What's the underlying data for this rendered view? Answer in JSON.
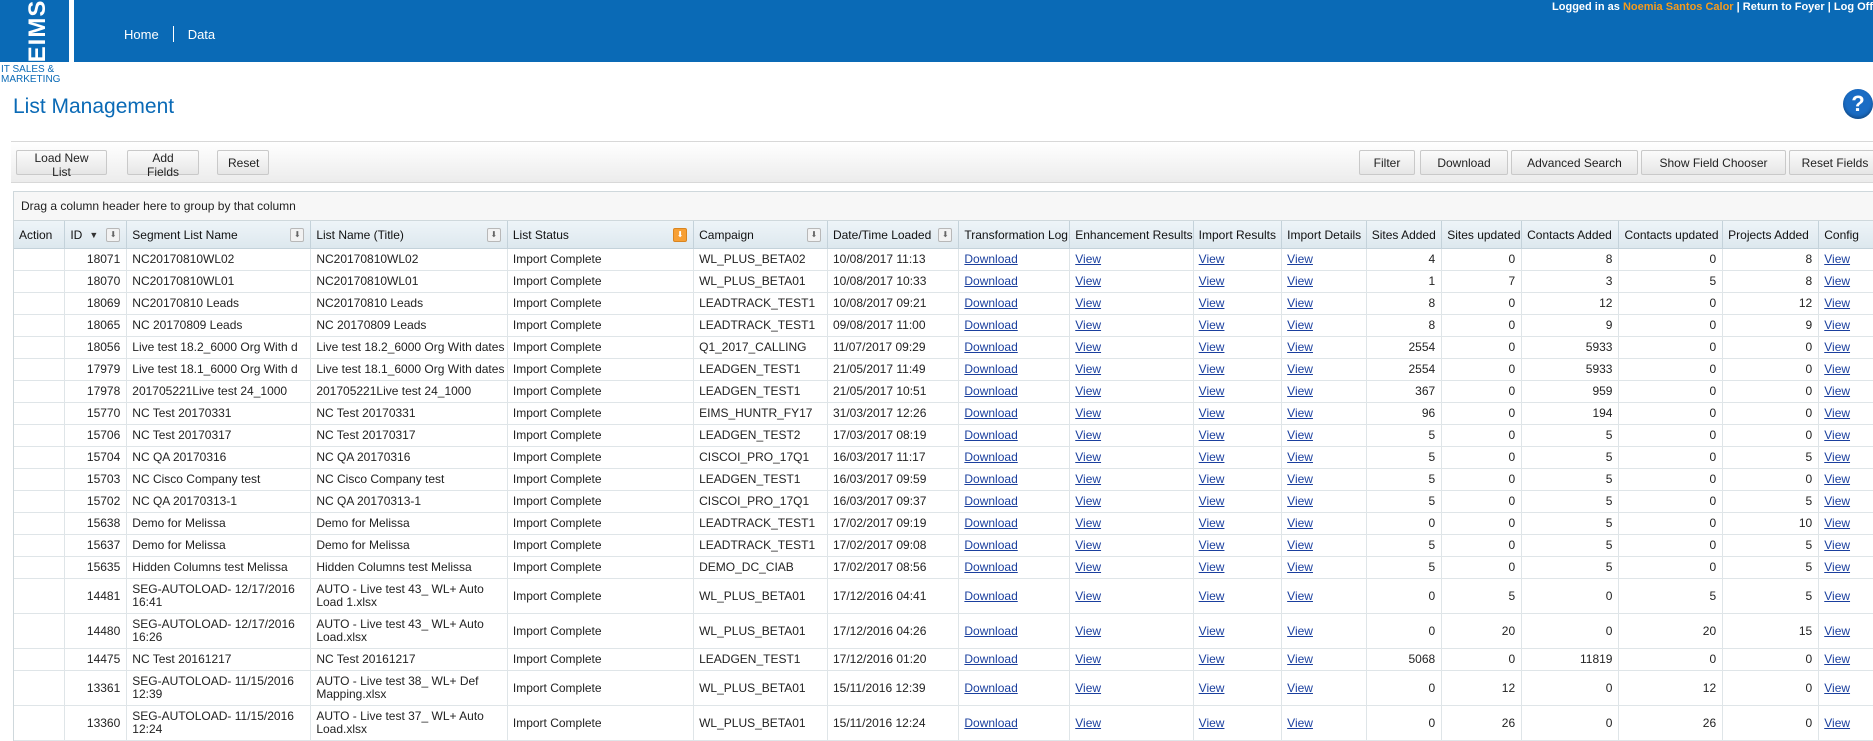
{
  "header": {
    "logo_text": "EIMS",
    "logo_subtitle": "IT SALES & MARKETING",
    "nav": [
      {
        "label": "Home"
      },
      {
        "label": "Data"
      }
    ],
    "user": {
      "prefix": "Logged in as",
      "name": "Noemia Santos Calor",
      "sep": "|",
      "return_label": "Return to Foyer",
      "logoff_label": "Log Off"
    }
  },
  "page": {
    "title": "List Management",
    "help_icon": "?"
  },
  "toolbar": {
    "left_buttons": [
      "Load New List",
      "Add Fields",
      "Reset"
    ],
    "right_buttons": [
      "Filter",
      "Download",
      "Advanced Search",
      "Show Field Chooser",
      "Reset Fields"
    ]
  },
  "grid": {
    "group_hint": "Drag a column header here to group by that column",
    "columns": [
      "Action",
      "ID",
      "Segment List Name",
      "List Name (Title)",
      "List Status",
      "Campaign",
      "Date/Time Loaded",
      "Transformation Log",
      "Enhancement Results",
      "Import Results",
      "Import Details",
      "Sites Added",
      "Sites updated",
      "Contacts Added",
      "Contacts updated",
      "Projects Added",
      "Config"
    ],
    "sort": {
      "column": "ID",
      "direction": "descending"
    },
    "active_filter_column": "List Status",
    "link_labels": {
      "download": "Download",
      "view": "View"
    },
    "rows": [
      {
        "id": "18071",
        "segment": "NC20170810WL02",
        "title": "NC20170810WL02",
        "status": "Import Complete",
        "campaign": "WL_PLUS_BETA02",
        "loaded": "10/08/2017 11:13",
        "sites_added": "4",
        "sites_updated": "0",
        "contacts_added": "8",
        "contacts_updated": "0",
        "projects_added": "8"
      },
      {
        "id": "18070",
        "segment": "NC20170810WL01",
        "title": "NC20170810WL01",
        "status": "Import Complete",
        "campaign": "WL_PLUS_BETA01",
        "loaded": "10/08/2017 10:33",
        "sites_added": "1",
        "sites_updated": "7",
        "contacts_added": "3",
        "contacts_updated": "5",
        "projects_added": "8"
      },
      {
        "id": "18069",
        "segment": "NC20170810 Leads",
        "title": "NC20170810 Leads",
        "status": "Import Complete",
        "campaign": "LEADTRACK_TEST1",
        "loaded": "10/08/2017 09:21",
        "sites_added": "8",
        "sites_updated": "0",
        "contacts_added": "12",
        "contacts_updated": "0",
        "projects_added": "12"
      },
      {
        "id": "18065",
        "segment": "NC 20170809 Leads",
        "title": "NC 20170809 Leads",
        "status": "Import Complete",
        "campaign": "LEADTRACK_TEST1",
        "loaded": "09/08/2017 11:00",
        "sites_added": "8",
        "sites_updated": "0",
        "contacts_added": "9",
        "contacts_updated": "0",
        "projects_added": "9"
      },
      {
        "id": "18056",
        "segment": "Live test 18.2_6000 Org With d",
        "title": "Live test 18.2_6000 Org With dates",
        "status": "Import Complete",
        "campaign": "Q1_2017_CALLING",
        "loaded": "11/07/2017 09:29",
        "sites_added": "2554",
        "sites_updated": "0",
        "contacts_added": "5933",
        "contacts_updated": "0",
        "projects_added": "0"
      },
      {
        "id": "17979",
        "segment": "Live test 18.1_6000 Org With d",
        "title": "Live test 18.1_6000 Org With dates",
        "status": "Import Complete",
        "campaign": "LEADGEN_TEST1",
        "loaded": "21/05/2017 11:49",
        "sites_added": "2554",
        "sites_updated": "0",
        "contacts_added": "5933",
        "contacts_updated": "0",
        "projects_added": "0"
      },
      {
        "id": "17978",
        "segment": "201705221Live test 24_1000",
        "title": "201705221Live test 24_1000",
        "status": "Import Complete",
        "campaign": "LEADGEN_TEST1",
        "loaded": "21/05/2017 10:51",
        "sites_added": "367",
        "sites_updated": "0",
        "contacts_added": "959",
        "contacts_updated": "0",
        "projects_added": "0"
      },
      {
        "id": "15770",
        "segment": "NC Test 20170331",
        "title": "NC Test 20170331",
        "status": "Import Complete",
        "campaign": "EIMS_HUNTR_FY17",
        "loaded": "31/03/2017 12:26",
        "sites_added": "96",
        "sites_updated": "0",
        "contacts_added": "194",
        "contacts_updated": "0",
        "projects_added": "0"
      },
      {
        "id": "15706",
        "segment": "NC Test 20170317",
        "title": "NC Test 20170317",
        "status": "Import Complete",
        "campaign": "LEADGEN_TEST2",
        "loaded": "17/03/2017 08:19",
        "sites_added": "5",
        "sites_updated": "0",
        "contacts_added": "5",
        "contacts_updated": "0",
        "projects_added": "0"
      },
      {
        "id": "15704",
        "segment": "NC QA 20170316",
        "title": "NC QA 20170316",
        "status": "Import Complete",
        "campaign": "CISCOI_PRO_17Q1",
        "loaded": "16/03/2017 11:17",
        "sites_added": "5",
        "sites_updated": "0",
        "contacts_added": "5",
        "contacts_updated": "0",
        "projects_added": "5"
      },
      {
        "id": "15703",
        "segment": "NC Cisco Company test",
        "title": "NC Cisco Company test",
        "status": "Import Complete",
        "campaign": "LEADGEN_TEST1",
        "loaded": "16/03/2017 09:59",
        "sites_added": "5",
        "sites_updated": "0",
        "contacts_added": "5",
        "contacts_updated": "0",
        "projects_added": "0"
      },
      {
        "id": "15702",
        "segment": "NC QA 20170313-1",
        "title": "NC QA 20170313-1",
        "status": "Import Complete",
        "campaign": "CISCOI_PRO_17Q1",
        "loaded": "16/03/2017 09:37",
        "sites_added": "5",
        "sites_updated": "0",
        "contacts_added": "5",
        "contacts_updated": "0",
        "projects_added": "5"
      },
      {
        "id": "15638",
        "segment": "Demo for Melissa",
        "title": "Demo for Melissa",
        "status": "Import Complete",
        "campaign": "LEADTRACK_TEST1",
        "loaded": "17/02/2017 09:19",
        "sites_added": "0",
        "sites_updated": "0",
        "contacts_added": "5",
        "contacts_updated": "0",
        "projects_added": "10"
      },
      {
        "id": "15637",
        "segment": "Demo for Melissa",
        "title": "Demo for Melissa",
        "status": "Import Complete",
        "campaign": "LEADTRACK_TEST1",
        "loaded": "17/02/2017 09:08",
        "sites_added": "5",
        "sites_updated": "0",
        "contacts_added": "5",
        "contacts_updated": "0",
        "projects_added": "5"
      },
      {
        "id": "15635",
        "segment": "Hidden Columns test Melissa",
        "title": "Hidden Columns test Melissa",
        "status": "Import Complete",
        "campaign": "DEMO_DC_CIAB",
        "loaded": "17/02/2017 08:56",
        "sites_added": "5",
        "sites_updated": "0",
        "contacts_added": "5",
        "contacts_updated": "0",
        "projects_added": "5"
      },
      {
        "id": "14481",
        "segment": "SEG-AUTOLOAD- 12/17/2016 16:41",
        "title": "AUTO - Live test 43_ WL+ Auto Load 1.xlsx",
        "status": "Import Complete",
        "campaign": "WL_PLUS_BETA01",
        "loaded": "17/12/2016 04:41",
        "sites_added": "0",
        "sites_updated": "5",
        "contacts_added": "0",
        "contacts_updated": "5",
        "projects_added": "5"
      },
      {
        "id": "14480",
        "segment": "SEG-AUTOLOAD- 12/17/2016 16:26",
        "title": "AUTO - Live test 43_ WL+ Auto Load.xlsx",
        "status": "Import Complete",
        "campaign": "WL_PLUS_BETA01",
        "loaded": "17/12/2016 04:26",
        "sites_added": "0",
        "sites_updated": "20",
        "contacts_added": "0",
        "contacts_updated": "20",
        "projects_added": "15"
      },
      {
        "id": "14475",
        "segment": "NC Test 20161217",
        "title": "NC Test 20161217",
        "status": "Import Complete",
        "campaign": "LEADGEN_TEST1",
        "loaded": "17/12/2016 01:20",
        "sites_added": "5068",
        "sites_updated": "0",
        "contacts_added": "11819",
        "contacts_updated": "0",
        "projects_added": "0"
      },
      {
        "id": "13361",
        "segment": "SEG-AUTOLOAD- 11/15/2016 12:39",
        "title": "AUTO - Live test 38_ WL+ Def Mapping.xlsx",
        "status": "Import Complete",
        "campaign": "WL_PLUS_BETA01",
        "loaded": "15/11/2016 12:39",
        "sites_added": "0",
        "sites_updated": "12",
        "contacts_added": "0",
        "contacts_updated": "12",
        "projects_added": "0"
      },
      {
        "id": "13360",
        "segment": "SEG-AUTOLOAD- 11/15/2016 12:24",
        "title": "AUTO - Live test 37_ WL+ Auto Load.xlsx",
        "status": "Import Complete",
        "campaign": "WL_PLUS_BETA01",
        "loaded": "15/11/2016 12:24",
        "sites_added": "0",
        "sites_updated": "26",
        "contacts_added": "0",
        "contacts_updated": "26",
        "projects_added": "0"
      }
    ]
  }
}
